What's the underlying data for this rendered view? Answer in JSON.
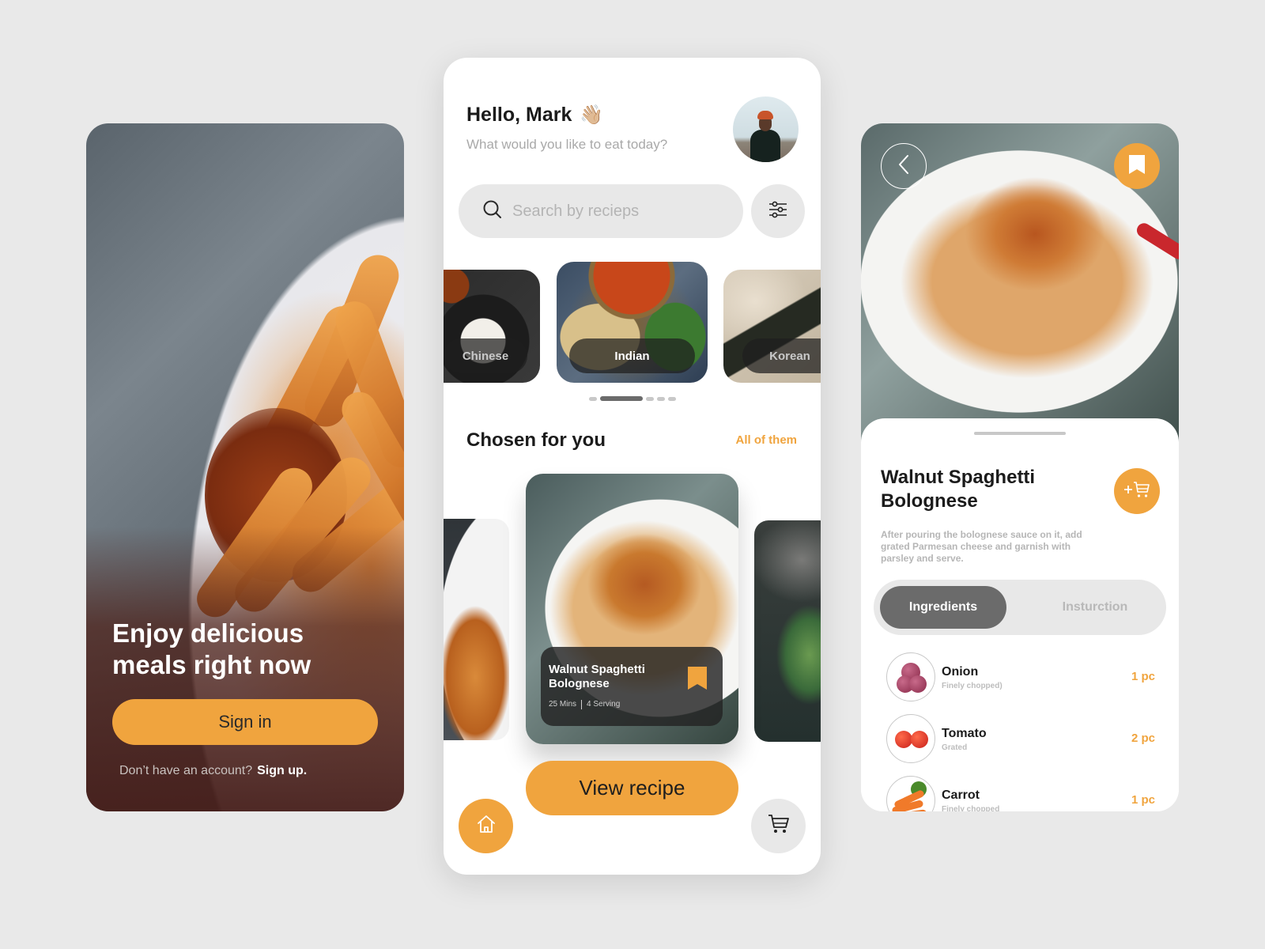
{
  "colors": {
    "accent": "#f0a43e",
    "dark_text": "#1b1b1b",
    "muted_text": "#a9a9a9",
    "chip_bg": "#e8e8e8",
    "active_tab": "#6b6b6b",
    "page_bg": "#e9e9e9"
  },
  "welcome": {
    "headline": "Enjoy delicious meals right now",
    "signin_label": "Sign in",
    "no_account_text": "Don’t have an account?",
    "signup_label": "Sign up."
  },
  "home": {
    "greeting": "Hello, Mark",
    "greeting_emoji": "👋🏼",
    "subtitle": "What would you like to eat today?",
    "avatar_icon": "user-avatar",
    "search": {
      "placeholder": "Search by recieps",
      "value": "",
      "icon": "search-icon"
    },
    "filter_icon": "sliders-icon",
    "categories": [
      {
        "label": "Chinese",
        "active": false
      },
      {
        "label": "Indian",
        "active": true
      },
      {
        "label": "Korean",
        "active": false
      }
    ],
    "carousel": {
      "pages": 5,
      "active_index": 1
    },
    "section_title": "Chosen for you",
    "all_link": "All of them",
    "featured": {
      "title": "Walnut Spaghetti Bolognese",
      "time": "25 Mins",
      "servings": "4 Serving",
      "bookmark_icon": "bookmark-icon"
    },
    "view_recipe_label": "View recipe",
    "nav": {
      "home_icon": "home-icon",
      "cart_icon": "cart-icon"
    }
  },
  "detail": {
    "back_icon": "chevron-left-icon",
    "bookmark_icon": "bookmark-icon",
    "title": "Walnut Spaghetti Bolognese",
    "add_to_cart_icon": "add-to-cart-icon",
    "description": "After pouring the bolognese sauce on it, add grated Parmesan cheese and garnish with parsley and serve.",
    "tabs": [
      {
        "label": "Ingredients",
        "active": true
      },
      {
        "label": "Insturction",
        "active": false
      }
    ],
    "ingredients": [
      {
        "name": "Onion",
        "note": "Finely chopped)",
        "qty": "1 pc"
      },
      {
        "name": "Tomato",
        "note": "Grated",
        "qty": "2 pc"
      },
      {
        "name": "Carrot",
        "note": "Finely chopped",
        "qty": "1 pc"
      }
    ]
  }
}
